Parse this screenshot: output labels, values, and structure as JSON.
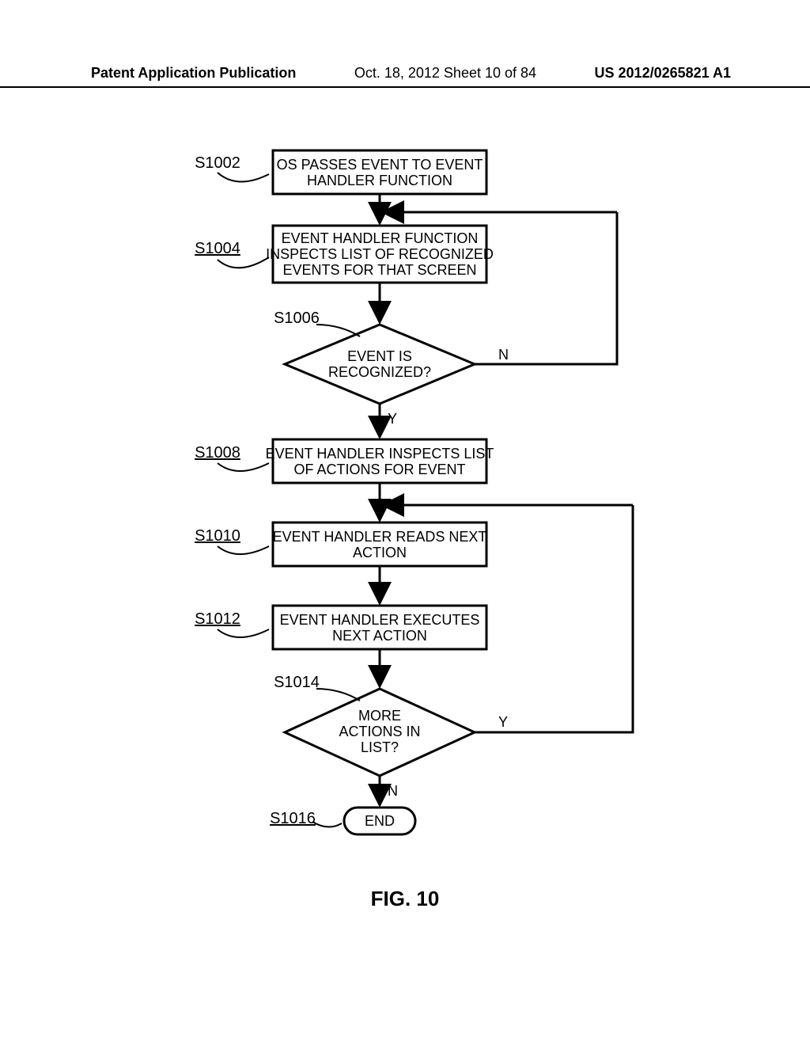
{
  "header": {
    "left": "Patent Application Publication",
    "mid": "Oct. 18, 2012  Sheet 10 of 84",
    "right": "US 2012/0265821 A1"
  },
  "figure_label": "FIG. 10",
  "steps": {
    "s1002": {
      "ref": "S1002",
      "text1": "OS PASSES EVENT TO EVENT",
      "text2": "HANDLER FUNCTION"
    },
    "s1004": {
      "ref": "S1004",
      "text1": "EVENT HANDLER FUNCTION",
      "text2": "INSPECTS LIST OF RECOGNIZED",
      "text3": "EVENTS FOR THAT SCREEN"
    },
    "s1006": {
      "ref": "S1006",
      "text1": "EVENT IS",
      "text2": "RECOGNIZED?",
      "yes": "Y",
      "no": "N"
    },
    "s1008": {
      "ref": "S1008",
      "text1": "EVENT HANDLER INSPECTS LIST",
      "text2": "OF ACTIONS FOR EVENT"
    },
    "s1010": {
      "ref": "S1010",
      "text1": "EVENT HANDLER READS NEXT",
      "text2": "ACTION"
    },
    "s1012": {
      "ref": "S1012",
      "text1": "EVENT HANDLER EXECUTES",
      "text2": "NEXT ACTION"
    },
    "s1014": {
      "ref": "S1014",
      "text1": "MORE",
      "text2": "ACTIONS IN",
      "text3": "LIST?",
      "yes": "Y",
      "no": "N"
    },
    "s1016": {
      "ref": "S1016",
      "text": "END"
    }
  }
}
